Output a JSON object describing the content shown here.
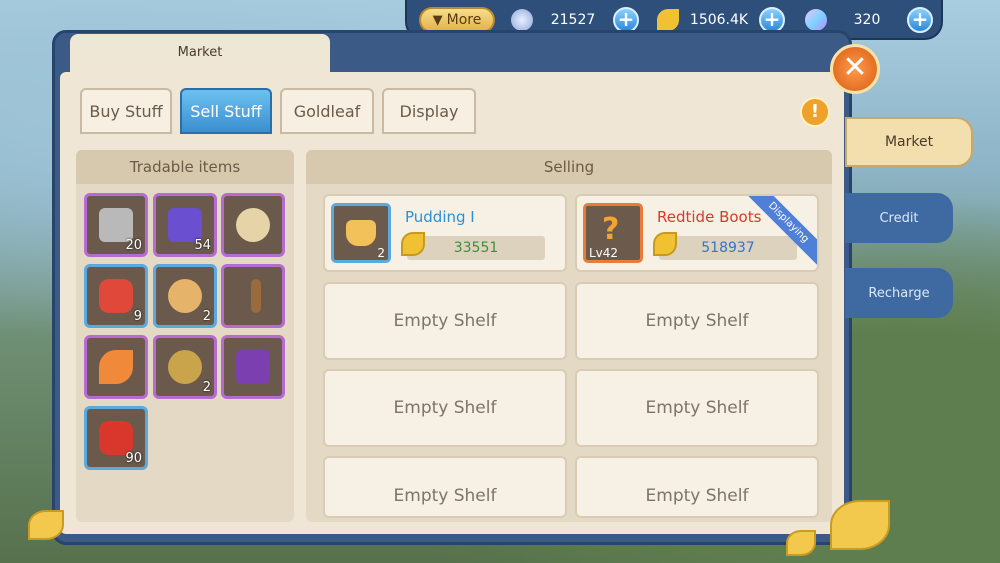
{
  "topbar": {
    "more_label": "More",
    "currency_1": {
      "icon": "feather-icon",
      "value": "21527"
    },
    "currency_2": {
      "icon": "goldleaf-icon",
      "value": "1506.4K"
    },
    "currency_3": {
      "icon": "gem-icon",
      "value": "320"
    }
  },
  "window": {
    "title": "Market"
  },
  "tabs": [
    {
      "label": "Buy Stuff"
    },
    {
      "label": "Sell Stuff"
    },
    {
      "label": "Goldleaf"
    },
    {
      "label": "Display"
    }
  ],
  "side_tabs": [
    {
      "label": "Market"
    },
    {
      "label": "Credit"
    },
    {
      "label": "Recharge"
    }
  ],
  "tradable": {
    "header": "Tradable items",
    "items": [
      {
        "icon": "stone-icon",
        "qty": "20"
      },
      {
        "icon": "purple-cube-icon",
        "qty": "54"
      },
      {
        "icon": "claw-ring-icon",
        "qty": ""
      },
      {
        "icon": "red-potion-icon",
        "qty": "9"
      },
      {
        "icon": "pie-icon",
        "qty": "2"
      },
      {
        "icon": "flute-icon",
        "qty": ""
      },
      {
        "icon": "feather-quill-icon",
        "qty": ""
      },
      {
        "icon": "compass-icon",
        "qty": "2"
      },
      {
        "icon": "treasure-chest-icon",
        "qty": ""
      },
      {
        "icon": "health-potion-icon",
        "qty": "90"
      }
    ]
  },
  "selling": {
    "header": "Selling",
    "listings": [
      {
        "name": "Pudding I",
        "price": "33551",
        "qty": "2",
        "icon": "pudding-icon"
      },
      {
        "name": "Redtide Boots",
        "price": "518937",
        "level": "Lv42",
        "badge": "Displaying",
        "icon": "mystery-boots-icon"
      }
    ],
    "empty_label": "Empty Shelf"
  },
  "colors": {
    "accent_blue": "#3a8fd0",
    "gold": "#f0c233"
  }
}
